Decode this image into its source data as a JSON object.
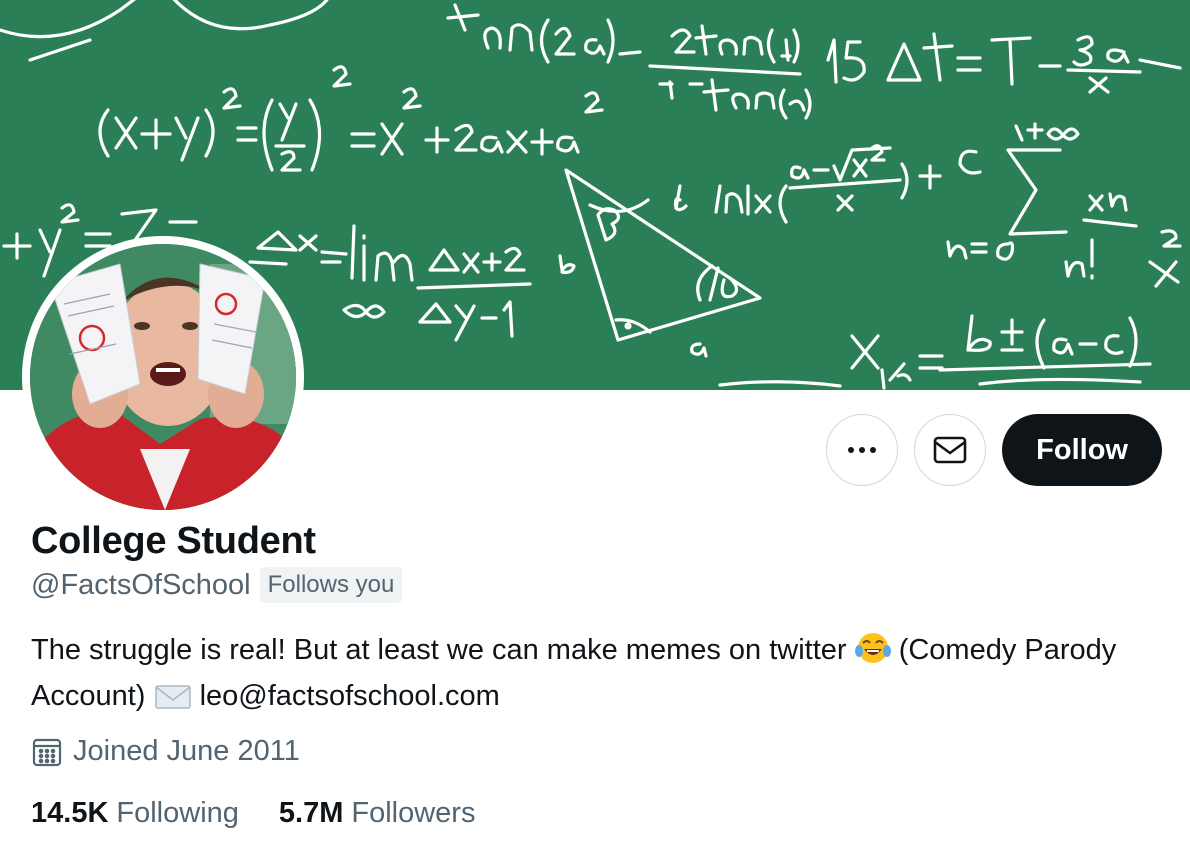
{
  "profile": {
    "display_name": "College Student",
    "handle": "@FactsOfSchool",
    "follows_you": "Follows you",
    "bio_text": "The struggle is real! But at least we can make memes on twitter",
    "bio_paren": "(Comedy Parody Account)",
    "bio_email": "leo@factsofschool.com",
    "joined": "Joined June 2011",
    "following_count": "14.5K",
    "following_label": "Following",
    "followers_count": "5.7M",
    "followers_label": "Followers"
  },
  "actions": {
    "follow_label": "Follow",
    "more_icon": "more-icon",
    "message_icon": "envelope-icon"
  },
  "banner": {
    "background_color": "#2b7f57",
    "chalk_color": "#ffffff"
  },
  "theme": {
    "text_primary": "#0f1419",
    "text_secondary": "#536471",
    "border": "#cfd9de"
  }
}
